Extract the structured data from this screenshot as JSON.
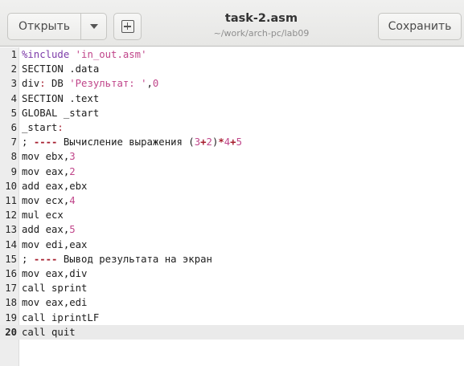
{
  "header": {
    "open_label": "Открыть",
    "save_label": "Сохранить",
    "title": "task-2.asm",
    "subtitle": "~/work/arch-pc/lab09"
  },
  "editor": {
    "current_line": 20,
    "lines": [
      {
        "n": "1",
        "parts": [
          {
            "t": "%include ",
            "c": "pre"
          },
          {
            "t": "'in_out.asm'",
            "c": "str"
          }
        ]
      },
      {
        "n": "2",
        "parts": [
          {
            "t": "SECTION .data",
            "c": ""
          }
        ]
      },
      {
        "n": "3",
        "parts": [
          {
            "t": "div",
            "c": ""
          },
          {
            "t": ":",
            "c": "lbl"
          },
          {
            "t": " DB ",
            "c": ""
          },
          {
            "t": "'Результат: '",
            "c": "str"
          },
          {
            "t": ",",
            "c": ""
          },
          {
            "t": "0",
            "c": "num"
          }
        ]
      },
      {
        "n": "4",
        "parts": [
          {
            "t": "SECTION .text",
            "c": ""
          }
        ]
      },
      {
        "n": "5",
        "parts": [
          {
            "t": "GLOBAL _start",
            "c": ""
          }
        ]
      },
      {
        "n": "6",
        "parts": [
          {
            "t": "_start",
            "c": ""
          },
          {
            "t": ":",
            "c": "lbl"
          }
        ]
      },
      {
        "n": "7",
        "parts": [
          {
            "t": "; ",
            "c": ""
          },
          {
            "t": "----",
            "c": "op"
          },
          {
            "t": " Вычисление выражения (",
            "c": ""
          },
          {
            "t": "3",
            "c": "num"
          },
          {
            "t": "+",
            "c": "op"
          },
          {
            "t": "2",
            "c": "num"
          },
          {
            "t": ")",
            "c": ""
          },
          {
            "t": "*",
            "c": "op"
          },
          {
            "t": "4",
            "c": "num"
          },
          {
            "t": "+",
            "c": "op"
          },
          {
            "t": "5",
            "c": "num"
          }
        ]
      },
      {
        "n": "8",
        "parts": [
          {
            "t": "mov ebx,",
            "c": ""
          },
          {
            "t": "3",
            "c": "num"
          }
        ]
      },
      {
        "n": "9",
        "parts": [
          {
            "t": "mov eax,",
            "c": ""
          },
          {
            "t": "2",
            "c": "num"
          }
        ]
      },
      {
        "n": "10",
        "parts": [
          {
            "t": "add eax,ebx",
            "c": ""
          }
        ]
      },
      {
        "n": "11",
        "parts": [
          {
            "t": "mov ecx,",
            "c": ""
          },
          {
            "t": "4",
            "c": "num"
          }
        ]
      },
      {
        "n": "12",
        "parts": [
          {
            "t": "mul ecx",
            "c": ""
          }
        ]
      },
      {
        "n": "13",
        "parts": [
          {
            "t": "add eax,",
            "c": ""
          },
          {
            "t": "5",
            "c": "num"
          }
        ]
      },
      {
        "n": "14",
        "parts": [
          {
            "t": "mov edi,eax",
            "c": ""
          }
        ]
      },
      {
        "n": "15",
        "parts": [
          {
            "t": "; ",
            "c": ""
          },
          {
            "t": "----",
            "c": "op"
          },
          {
            "t": " Вывод результата на экран",
            "c": ""
          }
        ]
      },
      {
        "n": "16",
        "parts": [
          {
            "t": "mov eax,div",
            "c": ""
          }
        ]
      },
      {
        "n": "17",
        "parts": [
          {
            "t": "call sprint",
            "c": ""
          }
        ]
      },
      {
        "n": "18",
        "parts": [
          {
            "t": "mov eax,edi",
            "c": ""
          }
        ]
      },
      {
        "n": "19",
        "parts": [
          {
            "t": "call iprintLF",
            "c": ""
          }
        ]
      },
      {
        "n": "20",
        "parts": [
          {
            "t": "call quit",
            "c": ""
          }
        ]
      }
    ]
  }
}
